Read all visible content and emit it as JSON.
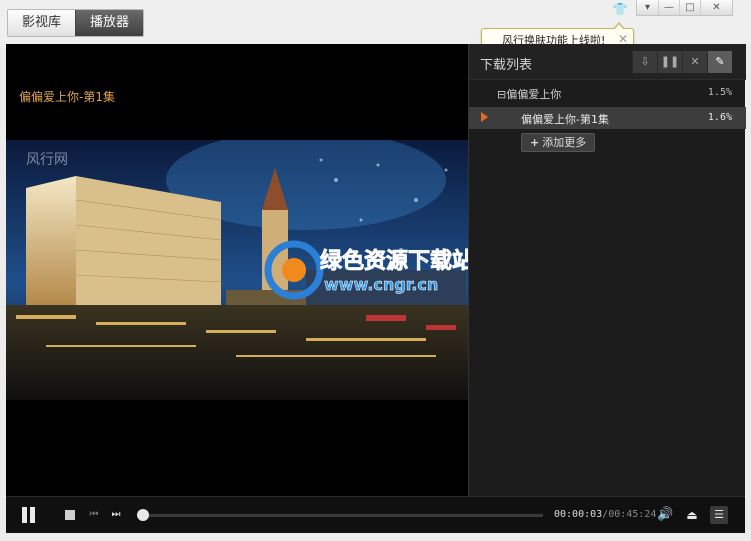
{
  "tabs": [
    {
      "label": "影视库",
      "active": false
    },
    {
      "label": "播放器",
      "active": true
    }
  ],
  "window": {
    "skin_icon": "tshirt-icon",
    "buttons": [
      {
        "icon": "dropdown-icon",
        "glyph": "▾"
      },
      {
        "icon": "minimize-icon",
        "glyph": "—"
      },
      {
        "icon": "maximize-icon",
        "glyph": "□"
      },
      {
        "icon": "close-icon",
        "glyph": "✕"
      }
    ]
  },
  "tooltip": {
    "text": "风行换肤功能上线啦!",
    "close": "✕"
  },
  "video": {
    "title": "偏偏爱上你-第1集",
    "watermark_text": "风行网",
    "overlay_logo": "绿色资源下载站",
    "overlay_url": "www.cngr.cn"
  },
  "download_panel": {
    "title": "下载列表",
    "tools": [
      {
        "icon": "download-icon",
        "glyph": "⇩"
      },
      {
        "icon": "pause-icon",
        "glyph": "❚❚"
      },
      {
        "icon": "delete-icon",
        "glyph": "✕"
      },
      {
        "icon": "clean-brush-icon",
        "glyph": "✎"
      }
    ],
    "group": {
      "label": "偏偏爱上你",
      "progress": "1.5%",
      "toggle": "⊟"
    },
    "items": [
      {
        "label": "偏偏爱上你-第1集",
        "progress": "1.6%"
      }
    ],
    "add_more": "添加更多",
    "add_icon": "+"
  },
  "controls": {
    "current_time": "00:00:03",
    "total_time": "/00:45:24",
    "progress_fraction": 0.001,
    "prev_glyph": "⏮",
    "next_glyph": "⏭",
    "volume_glyph": "🔊",
    "eject_glyph": "⏏",
    "list_glyph": "☰"
  },
  "colors": {
    "accent_orange": "#e46a1b",
    "title_orange": "#e3a24a",
    "player_bg": "#000000",
    "panel_bg": "#1c1c1c"
  }
}
